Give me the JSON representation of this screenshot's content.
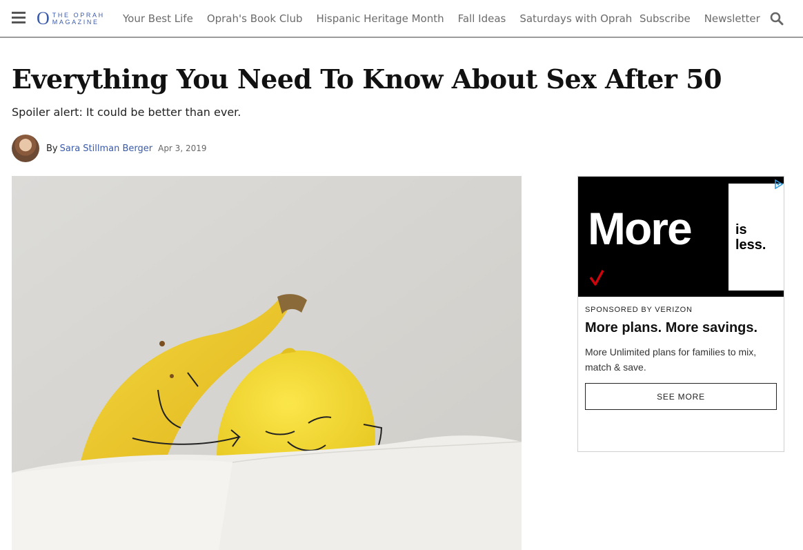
{
  "brand": {
    "logo_letter": "O",
    "logo_line1": "THE OPRAH",
    "logo_line2": "MAGAZINE",
    "color": "#3a5aa8"
  },
  "nav": {
    "menu_icon": "hamburger-icon",
    "links": [
      "Your Best Life",
      "Oprah's Book Club",
      "Hispanic Heritage Month",
      "Fall Ideas",
      "Saturdays with Oprah"
    ],
    "right_links": [
      "Subscribe",
      "Newsletter"
    ],
    "search_icon": "search-icon"
  },
  "article": {
    "headline": "Everything You Need To Know About Sex After 50",
    "dek": "Spoiler alert: It could be better than ever.",
    "by_label": "By",
    "author": "Sara Stillman Berger",
    "date": "Apr 3, 2019",
    "hero_alt": "banana and lemon with drawn faces cuddling in bed"
  },
  "ad": {
    "headline_big": "More",
    "headline_small": "is less.",
    "sponsor": "SPONSORED BY VERIZON",
    "title": "More plans. More savings.",
    "body": "More Unlimited plans for families to mix, match & save.",
    "cta": "SEE MORE",
    "brand_color": "#cd040b",
    "adchoices_icon": "adchoices-icon"
  }
}
